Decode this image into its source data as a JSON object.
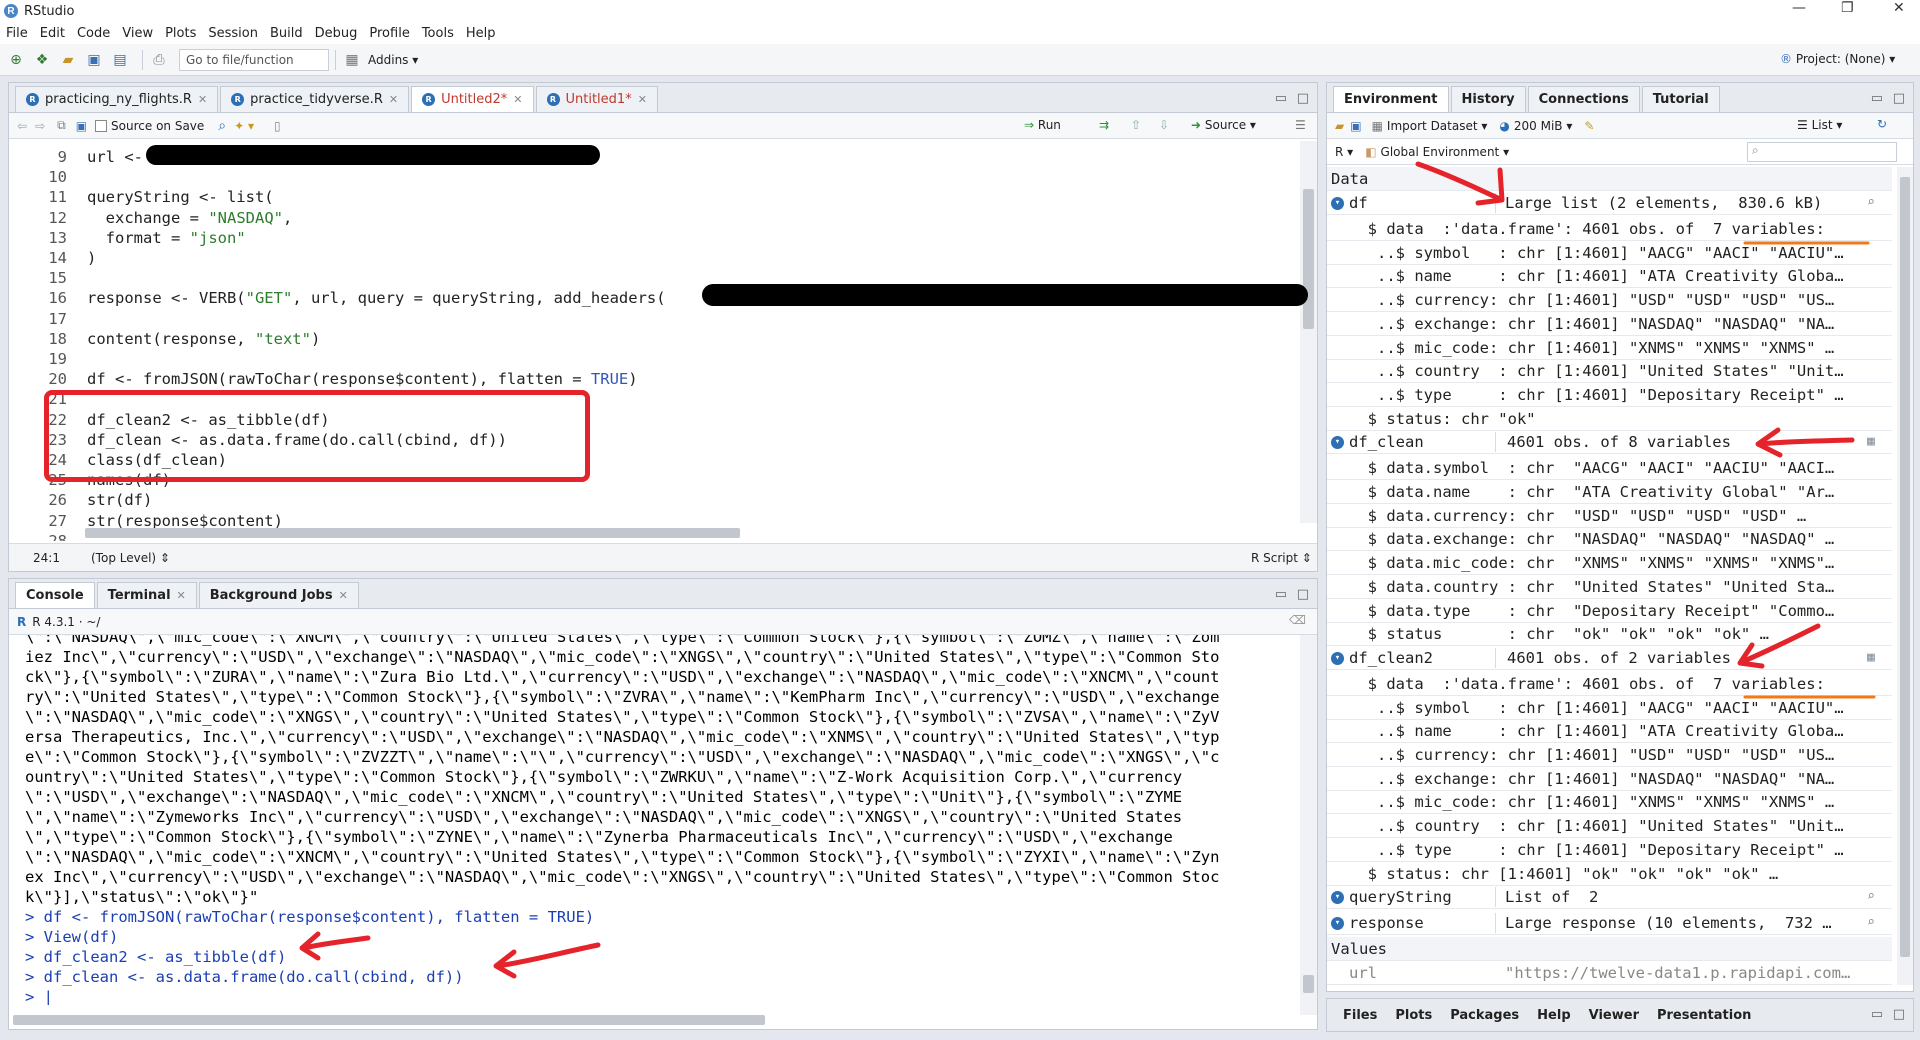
{
  "window": {
    "title": "RStudio",
    "project": "Project: (None)"
  },
  "menu": [
    "File",
    "Edit",
    "Code",
    "View",
    "Plots",
    "Session",
    "Build",
    "Debug",
    "Profile",
    "Tools",
    "Help"
  ],
  "toolbar": {
    "goto_placeholder": "Go to file/function",
    "addins": "Addins"
  },
  "editor": {
    "tabs": [
      {
        "label": "practicing_ny_flights.R",
        "active": false,
        "modified": false
      },
      {
        "label": "practice_tidyverse.R",
        "active": false,
        "modified": false
      },
      {
        "label": "Untitled2*",
        "active": true,
        "modified": true
      },
      {
        "label": "Untitled1*",
        "active": false,
        "modified": true
      }
    ],
    "source_on_save": "Source on Save",
    "run_label": "Run",
    "source_label": "Source",
    "status": {
      "position": "24:1",
      "scope": "(Top Level)",
      "filetype": "R Script"
    },
    "lines": [
      {
        "n": "9",
        "code": "url <- "
      },
      {
        "n": "10",
        "code": ""
      },
      {
        "n": "11",
        "code": "queryString <- list("
      },
      {
        "n": "12",
        "code": "  exchange = \"NASDAQ\","
      },
      {
        "n": "13",
        "code": "  format = \"json\""
      },
      {
        "n": "14",
        "code": ")"
      },
      {
        "n": "15",
        "code": ""
      },
      {
        "n": "16",
        "code": "response <- VERB(\"GET\", url, query = queryString, add_headers("
      },
      {
        "n": "17",
        "code": ""
      },
      {
        "n": "18",
        "code": "content(response, \"text\")"
      },
      {
        "n": "19",
        "code": ""
      },
      {
        "n": "20",
        "code": "df <- fromJSON(rawToChar(response$content), flatten = TRUE)"
      },
      {
        "n": "21",
        "code": ""
      },
      {
        "n": "22",
        "code": "df_clean2 <- as_tibble(df)"
      },
      {
        "n": "23",
        "code": "df_clean <- as.data.frame(do.call(cbind, df))"
      },
      {
        "n": "24",
        "code": "class(df_clean)"
      },
      {
        "n": "25",
        "code": "names(df)"
      },
      {
        "n": "26",
        "code": "str(df)"
      },
      {
        "n": "27",
        "code": "str(response$content)"
      },
      {
        "n": "28",
        "code": ""
      }
    ]
  },
  "console": {
    "tabs": [
      "Console",
      "Terminal",
      "Background Jobs"
    ],
    "r_version": "R 4.3.1 · ~/",
    "lines": [
      "\\\":\\\"NASDAQ\\\",\\\"mic_code\\\":\\\"XNCM\\\",\\\"country\\\":\\\"United States\\\",\\\"type\\\":\\\"Common Stock\\\"},{\\\"symbol\\\":\\\"ZOMZ\\\",\\\"name\\\":\\\"Zom",
      "iez Inc\\\",\\\"currency\\\":\\\"USD\\\",\\\"exchange\\\":\\\"NASDAQ\\\",\\\"mic_code\\\":\\\"XNGS\\\",\\\"country\\\":\\\"United States\\\",\\\"type\\\":\\\"Common Sto",
      "ck\\\"},{\\\"symbol\\\":\\\"ZURA\\\",\\\"name\\\":\\\"Zura Bio Ltd.\\\",\\\"currency\\\":\\\"USD\\\",\\\"exchange\\\":\\\"NASDAQ\\\",\\\"mic_code\\\":\\\"XNCM\\\",\\\"count",
      "ry\\\":\\\"United States\\\",\\\"type\\\":\\\"Common Stock\\\"},{\\\"symbol\\\":\\\"ZVRA\\\",\\\"name\\\":\\\"KemPharm Inc\\\",\\\"currency\\\":\\\"USD\\\",\\\"exchange",
      "\\\":\\\"NASDAQ\\\",\\\"mic_code\\\":\\\"XNGS\\\",\\\"country\\\":\\\"United States\\\",\\\"type\\\":\\\"Common Stock\\\"},{\\\"symbol\\\":\\\"ZVSA\\\",\\\"name\\\":\\\"ZyV",
      "ersa Therapeutics, Inc.\\\",\\\"currency\\\":\\\"USD\\\",\\\"exchange\\\":\\\"NASDAQ\\\",\\\"mic_code\\\":\\\"XNMS\\\",\\\"country\\\":\\\"United States\\\",\\\"typ",
      "e\\\":\\\"Common Stock\\\"},{\\\"symbol\\\":\\\"ZVZZT\\\",\\\"name\\\":\\\"\\\",\\\"currency\\\":\\\"USD\\\",\\\"exchange\\\":\\\"NASDAQ\\\",\\\"mic_code\\\":\\\"XNGS\\\",\\\"c",
      "ountry\\\":\\\"United States\\\",\\\"type\\\":\\\"Common Stock\\\"},{\\\"symbol\\\":\\\"ZWRKU\\\",\\\"name\\\":\\\"Z-Work Acquisition Corp.\\\",\\\"currency",
      "\\\":\\\"USD\\\",\\\"exchange\\\":\\\"NASDAQ\\\",\\\"mic_code\\\":\\\"XNCM\\\",\\\"country\\\":\\\"United States\\\",\\\"type\\\":\\\"Unit\\\"},{\\\"symbol\\\":\\\"ZYME",
      "\\\",\\\"name\\\":\\\"Zymeworks Inc\\\",\\\"currency\\\":\\\"USD\\\",\\\"exchange\\\":\\\"NASDAQ\\\",\\\"mic_code\\\":\\\"XNGS\\\",\\\"country\\\":\\\"United States",
      "\\\",\\\"type\\\":\\\"Common Stock\\\"},{\\\"symbol\\\":\\\"ZYNE\\\",\\\"name\\\":\\\"Zynerba Pharmaceuticals Inc\\\",\\\"currency\\\":\\\"USD\\\",\\\"exchange",
      "\\\":\\\"NASDAQ\\\",\\\"mic_code\\\":\\\"XNCM\\\",\\\"country\\\":\\\"United States\\\",\\\"type\\\":\\\"Common Stock\\\"},{\\\"symbol\\\":\\\"ZYXI\\\",\\\"name\\\":\\\"Zyn",
      "ex Inc\\\",\\\"currency\\\":\\\"USD\\\",\\\"exchange\\\":\\\"NASDAQ\\\",\\\"mic_code\\\":\\\"XNGS\\\",\\\"country\\\":\\\"United States\\\",\\\"type\\\":\\\"Common Stoc",
      "k\\\"}],\\\"status\\\":\\\"ok\\\"}\""
    ],
    "commands": [
      "> df <- fromJSON(rawToChar(response$content), flatten = TRUE)",
      "> View(df)",
      "> df_clean2 <- as_tibble(df)",
      "> df_clean <- as.data.frame(do.call(cbind, df))",
      "> |"
    ]
  },
  "environment": {
    "tabs": [
      "Environment",
      "History",
      "Connections",
      "Tutorial"
    ],
    "import_dataset": "Import Dataset",
    "memory": "200 MiB",
    "list_view": "List",
    "lang": "R",
    "scope": "Global Environment",
    "section_data": "Data",
    "section_values": "Values",
    "rows": [
      {
        "type": "obj",
        "name": "df",
        "value": "Large list (2 elements,  830.6 kB)"
      },
      {
        "type": "sub",
        "text": "  $ data  :'data.frame': 4601 obs. of  7 variables:"
      },
      {
        "type": "sub",
        "text": "   ..$ symbol   : chr [1:4601] \"AACG\" \"AACI\" \"AACIU\"…"
      },
      {
        "type": "sub",
        "text": "   ..$ name     : chr [1:4601] \"ATA Creativity Globa…"
      },
      {
        "type": "sub",
        "text": "   ..$ currency: chr [1:4601] \"USD\" \"USD\" \"USD\" \"US…"
      },
      {
        "type": "sub",
        "text": "   ..$ exchange: chr [1:4601] \"NASDAQ\" \"NASDAQ\" \"NA…"
      },
      {
        "type": "sub",
        "text": "   ..$ mic_code: chr [1:4601] \"XNMS\" \"XNMS\" \"XNMS\" …"
      },
      {
        "type": "sub",
        "text": "   ..$ country  : chr [1:4601] \"United States\" \"Unit…"
      },
      {
        "type": "sub",
        "text": "   ..$ type     : chr [1:4601] \"Depositary Receipt\" …"
      },
      {
        "type": "sub",
        "text": "  $ status: chr \"ok\""
      },
      {
        "type": "obj",
        "name": "df_clean",
        "value": "4601 obs. of 8 variables"
      },
      {
        "type": "sub",
        "text": "  $ data.symbol  : chr  \"AACG\" \"AACI\" \"AACIU\" \"AACI…"
      },
      {
        "type": "sub",
        "text": "  $ data.name    : chr  \"ATA Creativity Global\" \"Ar…"
      },
      {
        "type": "sub",
        "text": "  $ data.currency: chr  \"USD\" \"USD\" \"USD\" \"USD\" …"
      },
      {
        "type": "sub",
        "text": "  $ data.exchange: chr  \"NASDAQ\" \"NASDAQ\" \"NASDAQ\" …"
      },
      {
        "type": "sub",
        "text": "  $ data.mic_code: chr  \"XNMS\" \"XNMS\" \"XNMS\" \"XNMS\"…"
      },
      {
        "type": "sub",
        "text": "  $ data.country : chr  \"United States\" \"United Sta…"
      },
      {
        "type": "sub",
        "text": "  $ data.type    : chr  \"Depositary Receipt\" \"Commo…"
      },
      {
        "type": "sub",
        "text": "  $ status       : chr  \"ok\" \"ok\" \"ok\" \"ok\" …"
      },
      {
        "type": "obj",
        "name": "df_clean2",
        "value": "4601 obs. of 2 variables"
      },
      {
        "type": "sub",
        "text": "  $ data  :'data.frame': 4601 obs. of  7 variables:"
      },
      {
        "type": "sub",
        "text": "   ..$ symbol   : chr [1:4601] \"AACG\" \"AACI\" \"AACIU\"…"
      },
      {
        "type": "sub",
        "text": "   ..$ name     : chr [1:4601] \"ATA Creativity Globa…"
      },
      {
        "type": "sub",
        "text": "   ..$ currency: chr [1:4601] \"USD\" \"USD\" \"USD\" \"US…"
      },
      {
        "type": "sub",
        "text": "   ..$ exchange: chr [1:4601] \"NASDAQ\" \"NASDAQ\" \"NA…"
      },
      {
        "type": "sub",
        "text": "   ..$ mic_code: chr [1:4601] \"XNMS\" \"XNMS\" \"XNMS\" …"
      },
      {
        "type": "sub",
        "text": "   ..$ country  : chr [1:4601] \"United States\" \"Unit…"
      },
      {
        "type": "sub",
        "text": "   ..$ type     : chr [1:4601] \"Depositary Receipt\" …"
      },
      {
        "type": "sub",
        "text": "  $ status: chr [1:4601] \"ok\" \"ok\" \"ok\" \"ok\" …"
      },
      {
        "type": "obj",
        "name": "queryString",
        "value": "List of  2"
      },
      {
        "type": "obj",
        "name": "response",
        "value": "Large response (10 elements,  732 …"
      }
    ],
    "values": [
      {
        "name": "url",
        "value": "\"https://twelve-data1.p.rapidapi.com…"
      }
    ]
  },
  "files_pane": {
    "tabs": [
      "Files",
      "Plots",
      "Packages",
      "Help",
      "Viewer",
      "Presentation"
    ]
  },
  "colors": {
    "annotation_red": "#e5232a",
    "annotation_orange": "#f07a1a"
  }
}
